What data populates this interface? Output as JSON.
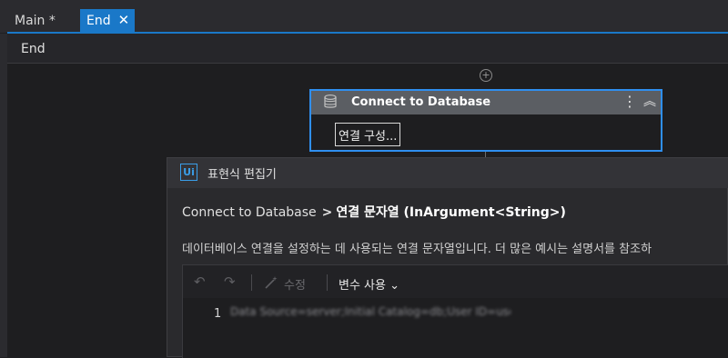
{
  "tabs": [
    {
      "label": "Main *"
    },
    {
      "label": "End",
      "close_glyph": "✕"
    }
  ],
  "breadcrumb": "End",
  "activity": {
    "title": "Connect to Database",
    "config_label": "연결 구성...",
    "menu_glyph": "⋮",
    "collapse_glyph": "︽"
  },
  "editor": {
    "logo": "Ui",
    "title": "표현식 편집기",
    "path_activity": "Connect to Database",
    "path_separator": ">",
    "path_property": "연결 문자열 (InArgument<String>)",
    "description": "데이터베이스 연결을 설정하는 데 사용되는 연결 문자열입니다. 더 많은 예시는 설명서를 참조하",
    "toolbar": {
      "undo_glyph": "↶",
      "redo_glyph": "↷",
      "edit_label": "수정",
      "use_variables_label": "변수 사용 ⌄"
    },
    "line_number": "1",
    "code_value": "Data Source=server;Initial Catalog=db;User ID=user;"
  },
  "colors": {
    "accent": "#1a78c8",
    "selection_border": "#2f8ff0",
    "activity_header": "#5b5e63",
    "background": "#1e1e20"
  }
}
